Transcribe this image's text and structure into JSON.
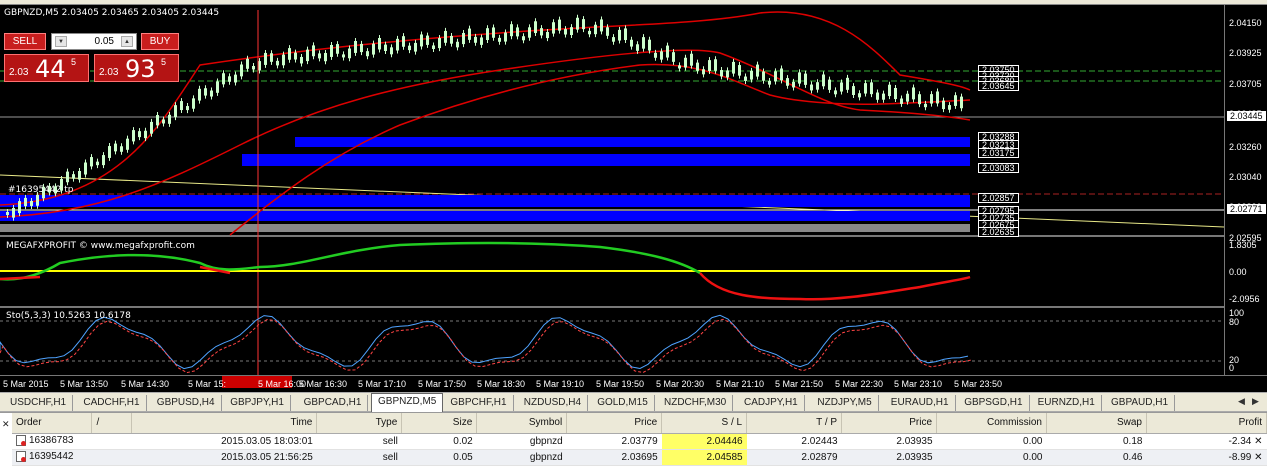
{
  "chart": {
    "header": "GBPNZD,M5  2.03405 2.03465 2.03405 2.03445",
    "order_label": "#16395442 tp",
    "indicator1_title": "MEGAFXPROFIT © www.megafxprofit.com",
    "indicator2_title": "Sto(5,3,3) 10.5263 10.6178",
    "price_axis": [
      "2.04150",
      "2.03925",
      "2.03705",
      "2.03485",
      "2.03260",
      "2.03040",
      "2.02820",
      "2.02595"
    ],
    "current_price": "2.03445",
    "line_price": "2.02771",
    "level_boxes": [
      "2.03288",
      "2.03213",
      "2.03175",
      "2.03083",
      "2.02857",
      "2.02795",
      "2.02735",
      "2.02675",
      "2.02635",
      "2.03750",
      "2.03720",
      "2.03680",
      "2.03645"
    ],
    "ind1_axis": [
      "1.8305",
      "0.00",
      "-2.0956"
    ],
    "ind2_axis": [
      "100",
      "80",
      "20",
      "0"
    ],
    "time_labels": [
      "5 Mar 2015",
      "5 Mar 13:50",
      "5 Mar 14:30",
      "5 Mar 15:",
      "5 Mar 16:00",
      "5 Mar 16:30",
      "5 Mar 17:10",
      "5 Mar 17:50",
      "5 Mar 18:30",
      "5 Mar 19:10",
      "5 Mar 19:50",
      "5 Mar 20:30",
      "5 Mar 21:10",
      "5 Mar 21:50",
      "5 Mar 22:30",
      "5 Mar 23:10",
      "5 Mar 23:50"
    ]
  },
  "trade_panel": {
    "sell_label": "SELL",
    "buy_label": "BUY",
    "lot_value": "0.05",
    "sell_big": "2.03",
    "sell_pips": "44",
    "sell_frac": "5",
    "buy_big": "2.03",
    "buy_pips": "93",
    "buy_frac": "5"
  },
  "tabs": [
    "USDCHF,H1",
    "CADCHF,H1",
    "GBPUSD,H4",
    "GBPJPY,H1",
    "GBPCAD,H1",
    "GBPNZD,M5",
    "GBPCHF,H1",
    "NZDUSD,H4",
    "GOLD,M15",
    "NZDCHF,M30",
    "CADJPY,H1",
    "NZDJPY,M5",
    "EURAUD,H1",
    "GBPSGD,H1",
    "EURNZD,H1",
    "GBPAUD,H1"
  ],
  "active_tab": "GBPNZD,M5",
  "table": {
    "headers": [
      "Order",
      "/",
      "Time",
      "Type",
      "Size",
      "Symbol",
      "Price",
      "S / L",
      "T / P",
      "Price",
      "Commission",
      "Swap",
      "Profit"
    ],
    "rows": [
      [
        "16386783",
        "2015.03.05 18:03:01",
        "sell",
        "0.02",
        "gbpnzd",
        "2.03779",
        "2.04446",
        "2.02443",
        "2.03935",
        "0.00",
        "0.18",
        "-2.34"
      ],
      [
        "16395442",
        "2015.03.05 21:56:25",
        "sell",
        "0.05",
        "gbpnzd",
        "2.03695",
        "2.04585",
        "2.02879",
        "2.03935",
        "0.00",
        "0.46",
        "-8.99"
      ]
    ]
  },
  "colors": {
    "chart_bg": "#000000",
    "bull_candle": "#ccffcc",
    "band": "#dd0000",
    "level_band": "#0000ff",
    "megafx_up": "#22cc22",
    "megafx_down": "#ee1111",
    "zero_line": "#ffff00",
    "sl_highlight": "#ffff66"
  }
}
